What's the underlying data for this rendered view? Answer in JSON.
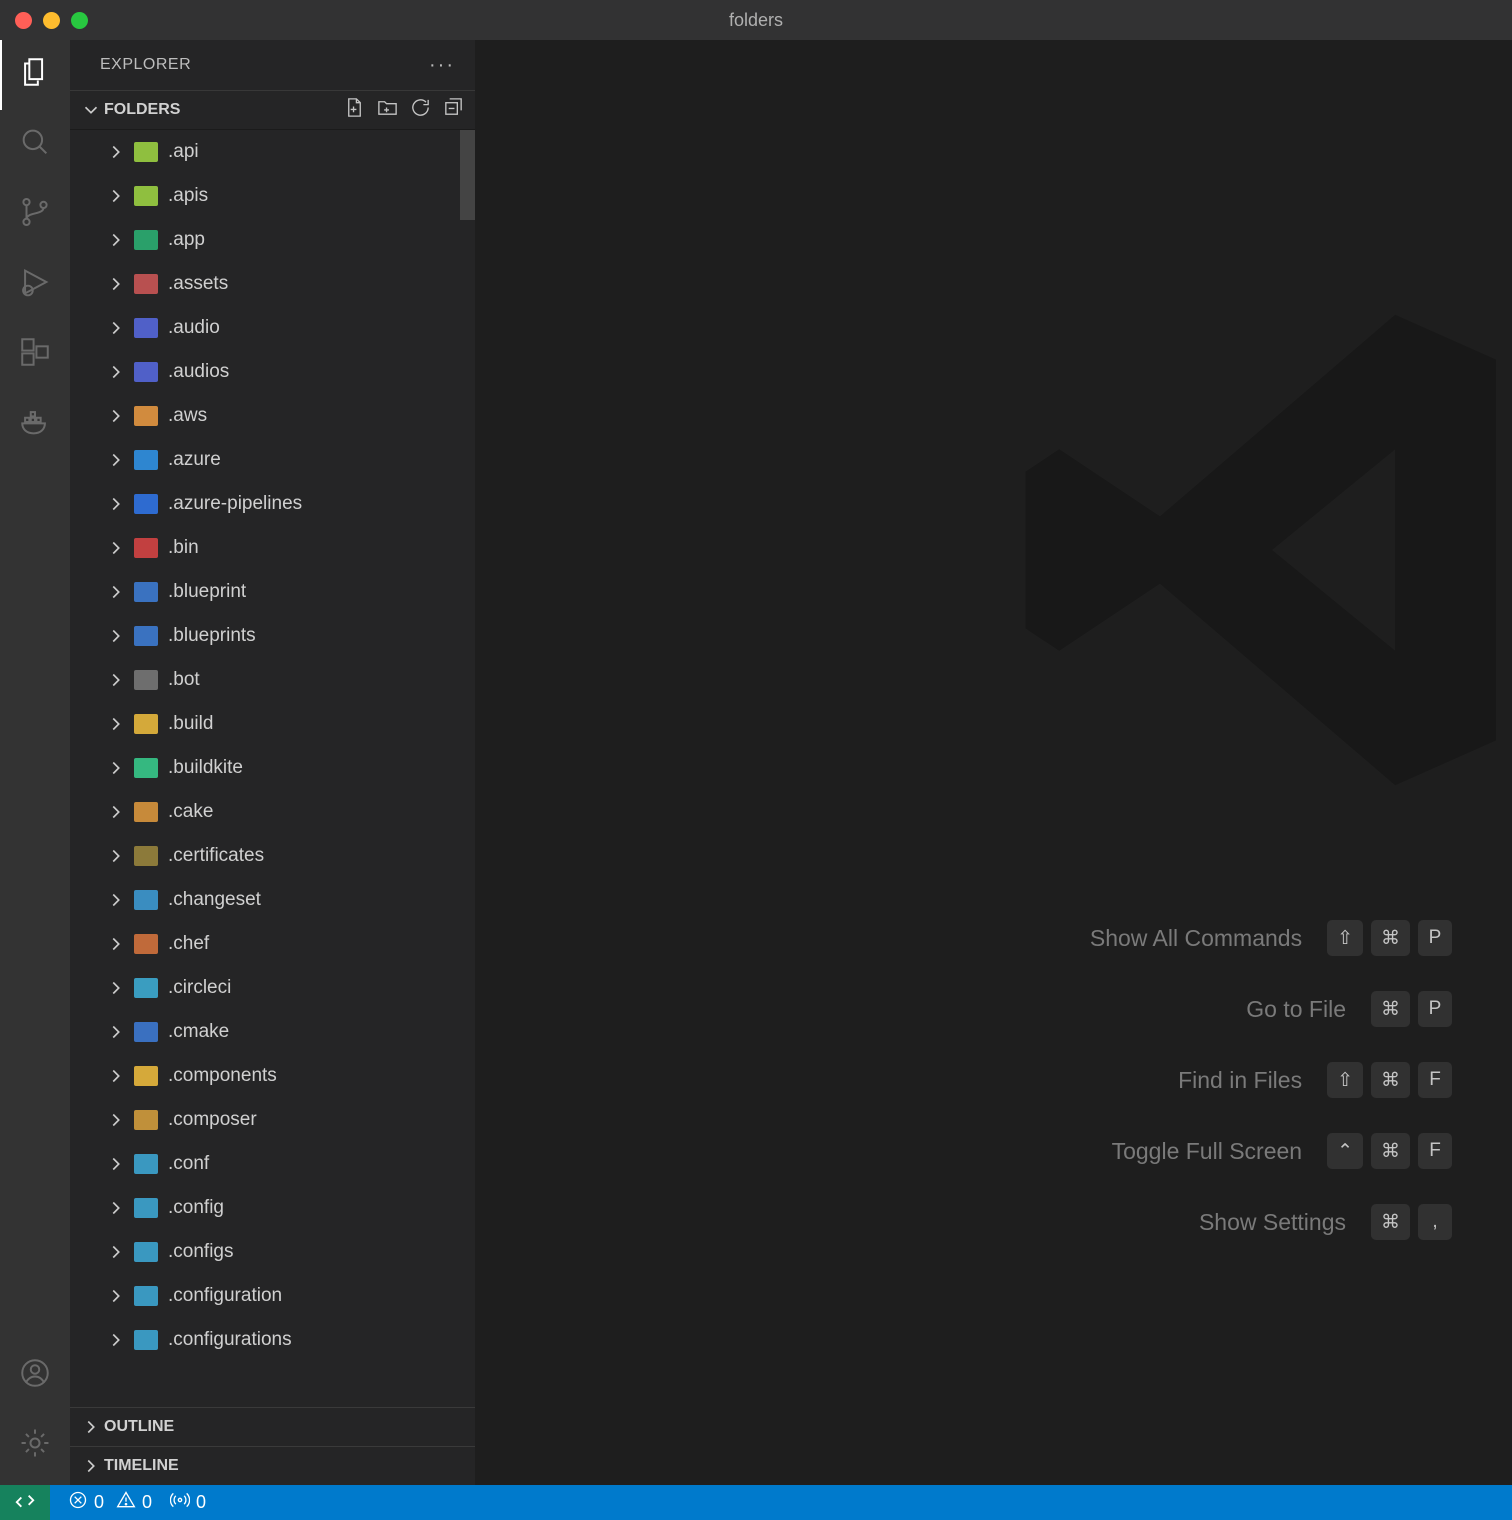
{
  "window": {
    "title": "folders"
  },
  "explorer": {
    "title": "EXPLORER",
    "section_label": "FOLDERS"
  },
  "outline": {
    "label": "OUTLINE"
  },
  "timeline": {
    "label": "TIMELINE"
  },
  "tree": [
    {
      "name": ".api",
      "color": "#8fbf3f"
    },
    {
      "name": ".apis",
      "color": "#8fbf3f"
    },
    {
      "name": ".app",
      "color": "#2aa06a"
    },
    {
      "name": ".assets",
      "color": "#b85050"
    },
    {
      "name": ".audio",
      "color": "#5060c8"
    },
    {
      "name": ".audios",
      "color": "#5060c8"
    },
    {
      "name": ".aws",
      "color": "#d18b3e"
    },
    {
      "name": ".azure",
      "color": "#2e86d0"
    },
    {
      "name": ".azure-pipelines",
      "color": "#2e6bd0"
    },
    {
      "name": ".bin",
      "color": "#c24040"
    },
    {
      "name": ".blueprint",
      "color": "#3a72c0"
    },
    {
      "name": ".blueprints",
      "color": "#3a72c0"
    },
    {
      "name": ".bot",
      "color": "#6e6e6e"
    },
    {
      "name": ".build",
      "color": "#d4a93a"
    },
    {
      "name": ".buildkite",
      "color": "#35b880"
    },
    {
      "name": ".cake",
      "color": "#c78a3a"
    },
    {
      "name": ".certificates",
      "color": "#8c7a3a"
    },
    {
      "name": ".changeset",
      "color": "#3a8dc0"
    },
    {
      "name": ".chef",
      "color": "#c06a3a"
    },
    {
      "name": ".circleci",
      "color": "#3a9dc0"
    },
    {
      "name": ".cmake",
      "color": "#3a70c0"
    },
    {
      "name": ".components",
      "color": "#d5a93a"
    },
    {
      "name": ".composer",
      "color": "#c0903a"
    },
    {
      "name": ".conf",
      "color": "#3a98c0"
    },
    {
      "name": ".config",
      "color": "#3a98c0"
    },
    {
      "name": ".configs",
      "color": "#3a98c0"
    },
    {
      "name": ".configuration",
      "color": "#3a98c0"
    },
    {
      "name": ".configurations",
      "color": "#3a98c0"
    }
  ],
  "tips": [
    {
      "label": "Show All Commands",
      "keys": [
        "⇧",
        "⌘",
        "P"
      ]
    },
    {
      "label": "Go to File",
      "keys": [
        "⌘",
        "P"
      ]
    },
    {
      "label": "Find in Files",
      "keys": [
        "⇧",
        "⌘",
        "F"
      ]
    },
    {
      "label": "Toggle Full Screen",
      "keys": [
        "⌃",
        "⌘",
        "F"
      ]
    },
    {
      "label": "Show Settings",
      "keys": [
        "⌘",
        ","
      ]
    }
  ],
  "status": {
    "errors": "0",
    "warnings": "0",
    "ports": "0"
  }
}
